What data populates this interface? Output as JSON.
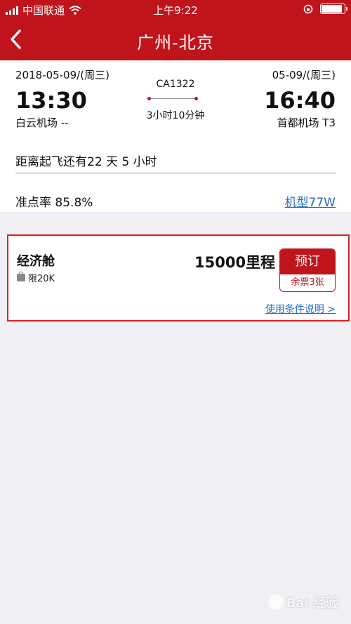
{
  "status_bar": {
    "carrier": "中国联通",
    "time": "上午9:22"
  },
  "nav": {
    "title": "广州-北京"
  },
  "flight": {
    "departure": {
      "date": "2018-05-09/(周三)",
      "time": "13:30",
      "airport": "白云机场 --"
    },
    "arrival": {
      "date": "05-09/(周三)",
      "time": "16:40",
      "airport": "首都机场 T3"
    },
    "flight_no": "CA1322",
    "duration": "3小时10分钟",
    "countdown": "距离起飞还有22 天 5 小时",
    "ontime_rate": "准点率 85.8%",
    "aircraft_link": "机型77W"
  },
  "fare": {
    "cabin": "经济舱",
    "baggage": "限20K",
    "miles": "15000里程",
    "book_label": "预订",
    "remaining": "余票3张",
    "terms_link": "使用条件说明 >"
  },
  "watermark": {
    "text": "Bai 经验"
  },
  "colors": {
    "brand": "#c0141c",
    "link": "#1e6cc8",
    "background": "#efeff4"
  }
}
